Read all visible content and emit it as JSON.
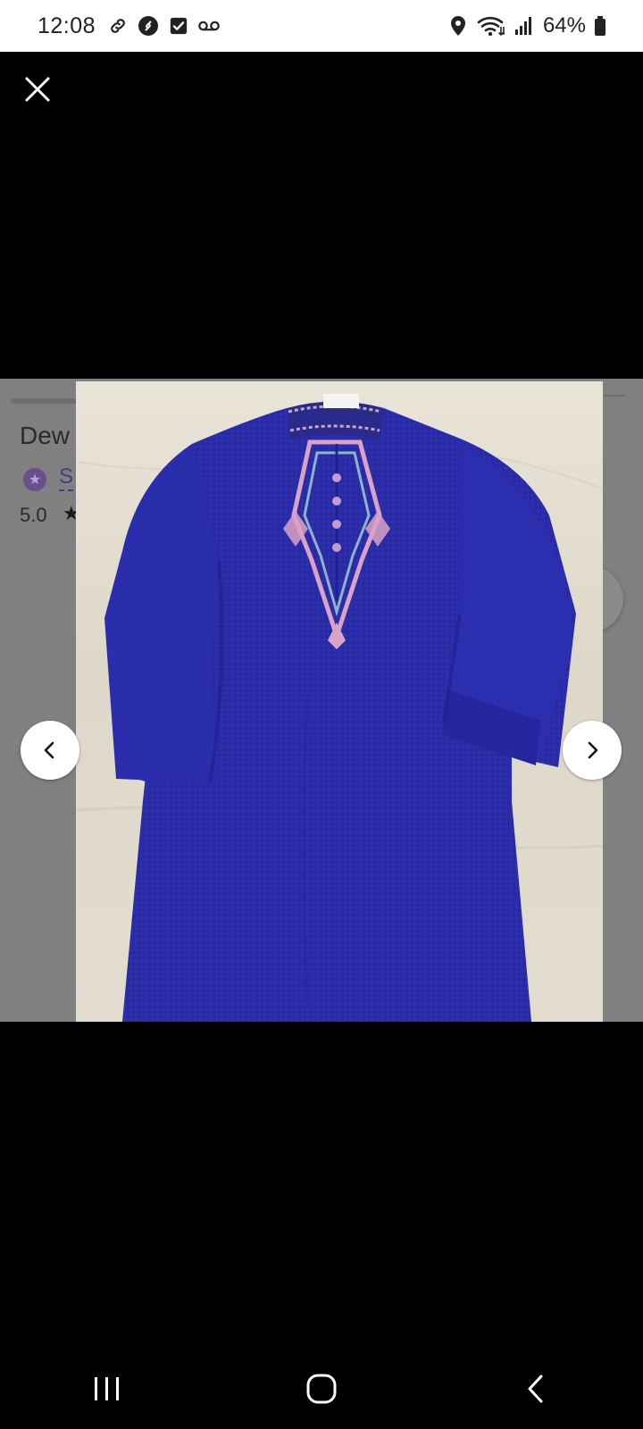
{
  "status_bar": {
    "time": "12:08",
    "battery_percent": "64%",
    "left_icons": [
      "link-icon",
      "shazam-icon",
      "checkbox-icon",
      "voicemail-icon"
    ],
    "right_icons": [
      "location-icon",
      "wifi-icon",
      "signal-icon",
      "battery-icon"
    ]
  },
  "viewer": {
    "close_icon": "close-icon",
    "prev_icon": "chevron-left-icon",
    "next_icon": "chevron-right-icon",
    "photo_subject": "blue kurta with embroidered collar",
    "colors": {
      "garment": "#2d2fb0",
      "embroidery": "#d9a2c7",
      "background": "#000000",
      "overlay": "#808080"
    }
  },
  "backdrop": {
    "title_fragment": "Dew",
    "shop_fragment": "S",
    "rating": "5.0"
  },
  "nav_bar": {
    "icons": [
      "recent-apps-icon",
      "home-icon",
      "back-icon"
    ]
  }
}
